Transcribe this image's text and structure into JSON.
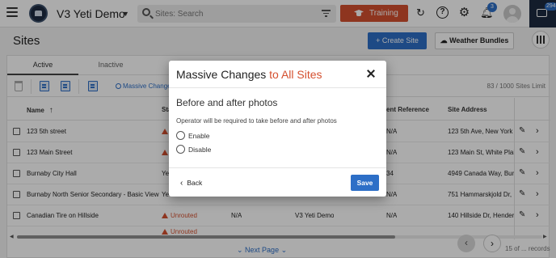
{
  "topbar": {
    "app_name": "V3 Yeti Demo",
    "search_placeholder": "Sites: Search",
    "training_label": "Training",
    "notification_count": "3",
    "chat_count": "294"
  },
  "page": {
    "title": "Sites",
    "create_label": "+ Create Site",
    "weather_label": "Weather Bundles"
  },
  "tabs": [
    "Active",
    "Inactive"
  ],
  "toolbar": {
    "massive_changes_label": "Massive Changes",
    "limit_text": "83 / 1000 Sites Limit"
  },
  "table": {
    "columns": {
      "name": "Name",
      "status": "Sta",
      "ref": "ent Reference",
      "address": "Site Address"
    },
    "rows": [
      {
        "name": "123 5th street",
        "status": "",
        "col3": "",
        "col4": "",
        "ref": "N/A",
        "address": "123 5th Ave, New York"
      },
      {
        "name": "123 Main Street",
        "status": "",
        "col3": "",
        "col4": "",
        "ref": "N/A",
        "address": "123 Main St, White Plain"
      },
      {
        "name": "Burnaby City Hall",
        "status": "Yes",
        "col3": "",
        "col4": "",
        "ref": "34",
        "address": "4949 Canada Way, Burn"
      },
      {
        "name": "Burnaby North Senior Secondary - Basic View",
        "status": "Ye",
        "col3": "",
        "col4": "",
        "ref": "N/A",
        "address": "751 Hammarskjold Dr, E"
      },
      {
        "name": "Canadian Tire on Hillside",
        "status": "Unrouted",
        "col3": "N/A",
        "col4": "V3 Yeti Demo",
        "ref": "N/A",
        "address": "140 Hillside Dr, Henders"
      },
      {
        "name": "",
        "status": "Unrouted",
        "col3": "",
        "col4": "",
        "ref": "",
        "address": ""
      }
    ]
  },
  "pagination": {
    "next_page_label": "Next Page",
    "records_text": "15 of ... records"
  },
  "modal": {
    "title_main": "Massive Changes ",
    "title_highlight": "to All Sites",
    "section_title": "Before and after photos",
    "description": "Operator will be required to take before and after photos",
    "options": [
      "Enable",
      "Disable"
    ],
    "back_label": "Back",
    "save_label": "Save"
  },
  "colors": {
    "accent": "#2d6fc7",
    "training": "#d4502f",
    "warning": "#d4502f",
    "nav_dark": "#1d2b40"
  }
}
